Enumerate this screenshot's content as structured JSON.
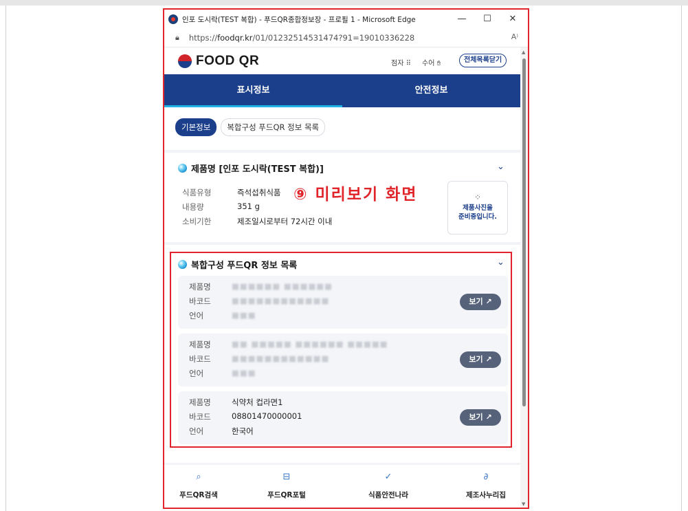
{
  "browser": {
    "title": "인포 도시락(TEST 복합) - 푸드QR종합정보장 - 프로필 1 - Microsoft Edge",
    "url_prefix": "https://",
    "url_domain": "foodqr.kr",
    "url_path": "/01/01232514531474?91=19010336228",
    "reader_icon": "A⁾",
    "minimize": "—",
    "maximize": "☐",
    "close": "✕"
  },
  "site": {
    "logo": "FOOD QR",
    "braille_label": "점자",
    "sign_label": "수어",
    "close_all_label": "전체목록닫기"
  },
  "tabs": [
    {
      "label": "표시정보",
      "active": true
    },
    {
      "label": "안전정보",
      "active": false
    }
  ],
  "chips": [
    {
      "label": "기본정보",
      "active": true
    },
    {
      "label": "복합구성 푸드QR 정보 목록",
      "active": false
    }
  ],
  "product_section": {
    "title": "제품명 [인포 도시락(TEST 복합)]",
    "rows": [
      {
        "key": "식품유형",
        "value": "즉석섭취식품"
      },
      {
        "key": "내용량",
        "value": "351 g"
      },
      {
        "key": "소비기한",
        "value": "제조일시로부터 72시간 이내"
      }
    ],
    "photo_message_line1": "제품사진을",
    "photo_message_line2": "준비중입니다."
  },
  "overlay_label": "⑨ 미리보기 화면",
  "composite_section": {
    "title": "복합구성 푸드QR 정보 목록",
    "view_label": "보기",
    "items": [
      {
        "name_key": "제품명",
        "name": "■■■■■■ ■■■■■■",
        "barcode_key": "바코드",
        "barcode": "■■■■■■■■■■■■",
        "lang_key": "언어",
        "lang": "■■■",
        "blurred": true
      },
      {
        "name_key": "제품명",
        "name": "■■ ■■■■■ ■■■■■■ ■■■■■",
        "barcode_key": "바코드",
        "barcode": "■■■■■■■■■■■■",
        "lang_key": "언어",
        "lang": "■■■",
        "blurred": true
      },
      {
        "name_key": "제품명",
        "name": "식약처 컵라면1",
        "barcode_key": "바코드",
        "barcode": "08801470000001",
        "lang_key": "언어",
        "lang": "한국어",
        "blurred": false
      }
    ]
  },
  "footer_nav": [
    {
      "label": "푸드QR검색",
      "icon": "search-icon"
    },
    {
      "label": "푸드QR포털",
      "icon": "qr-icon"
    },
    {
      "label": "식품안전나라",
      "icon": "check-icon"
    },
    {
      "label": "제조사누리집",
      "icon": "link-icon"
    }
  ],
  "colors": {
    "brand_navy": "#1b3f8b",
    "highlight_red": "#e0242a",
    "tab_indicator": "#1fb3e5"
  }
}
